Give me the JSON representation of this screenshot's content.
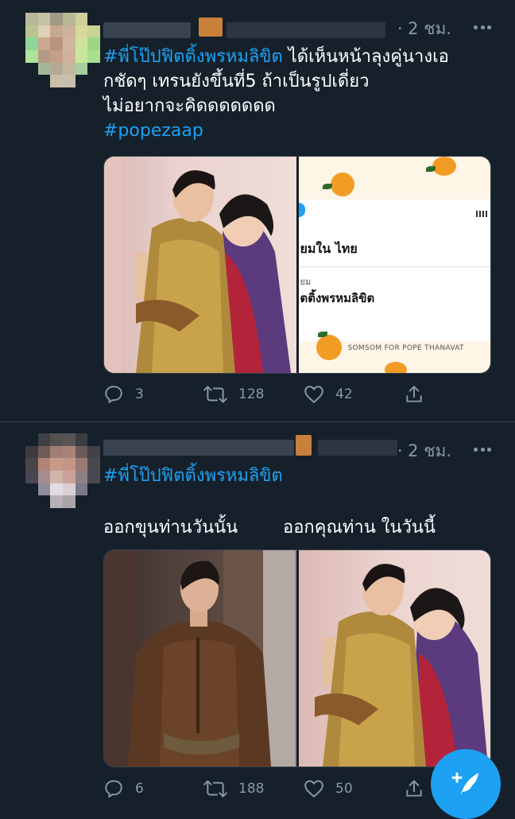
{
  "tweets": [
    {
      "time": "· 2 ชม.",
      "hashtag1": "#พี่โป๊ปฟิตติ้งพรหมลิขิต",
      "text_line1_rest": " ได้เห็นหน้าลุงคู่นางเอ",
      "text_line2": "กชัดๆ เทรนยังขึ้นที่5 ถ้าเป็นรูปเดี่ยว",
      "text_line3": "ไม่อยากจะคิดดดดดดด",
      "hashtag2": "#popezaap",
      "screenshot_card": {
        "line1": "ยมใน ไทย",
        "line2": "ยม",
        "line3": "ตติ้งพรหมลิขิต",
        "footer": "SOMSOM FOR POPE THANAVAT"
      },
      "replies": "3",
      "retweets": "128",
      "likes": "42"
    },
    {
      "time": "· 2 ชม.",
      "hashtag1": "#พี่โป๊ปฟิตติ้งพรหมลิขิต",
      "caption_left": "ออกขุนท่านวันนั้น",
      "caption_right": "ออกคุณท่าน ในวันนี้",
      "replies": "6",
      "retweets": "188",
      "likes": "50"
    }
  ],
  "icons": {
    "reply": "reply-icon",
    "retweet": "retweet-icon",
    "like": "heart-icon",
    "share": "share-icon",
    "compose": "compose-tweet-icon",
    "more": "more-icon"
  },
  "colors": {
    "background": "#15202b",
    "link": "#1da1f2",
    "muted": "#8899a6",
    "divider": "#38444d"
  }
}
